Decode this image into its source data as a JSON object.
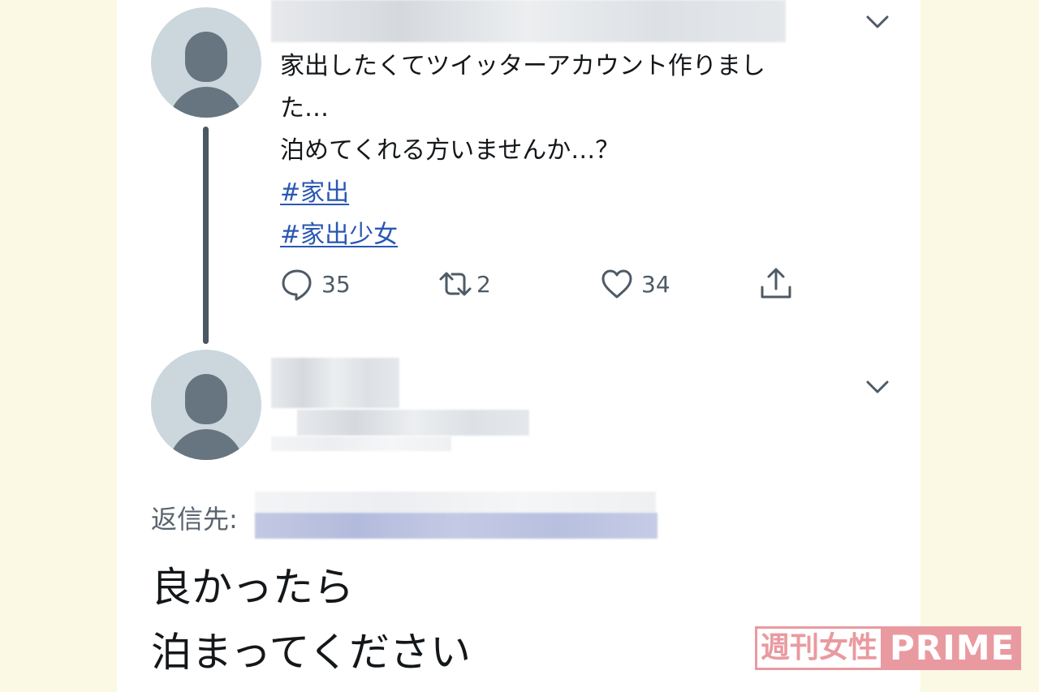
{
  "tweet": {
    "lines": [
      "家出したくてツイッターアカウント作りまし",
      "た…",
      "泊めてくれる方いませんか…？"
    ],
    "hashtags": [
      "#家出",
      "#家出少女"
    ],
    "actions": {
      "reply_count": "35",
      "retweet_count": "2",
      "like_count": "34"
    }
  },
  "reply": {
    "reply_to_label": "返信先:",
    "lines": [
      "良かったら",
      "泊まってください"
    ]
  },
  "watermark": {
    "jp": "週刊女性",
    "en": "PRIME"
  },
  "icons": {
    "reply": "speech-bubble-icon",
    "retweet": "retweet-icon",
    "like": "heart-icon",
    "share": "share-icon",
    "menu": "chevron-down-icon",
    "avatar": "default-profile-icon"
  },
  "colors": {
    "background": "#fbf8e4",
    "card": "#ffffff",
    "hashtag": "#2a57b4",
    "icon_gray": "#4e5a66",
    "avatar_bg": "#ccd6dd",
    "watermark": "#e99aa0"
  }
}
